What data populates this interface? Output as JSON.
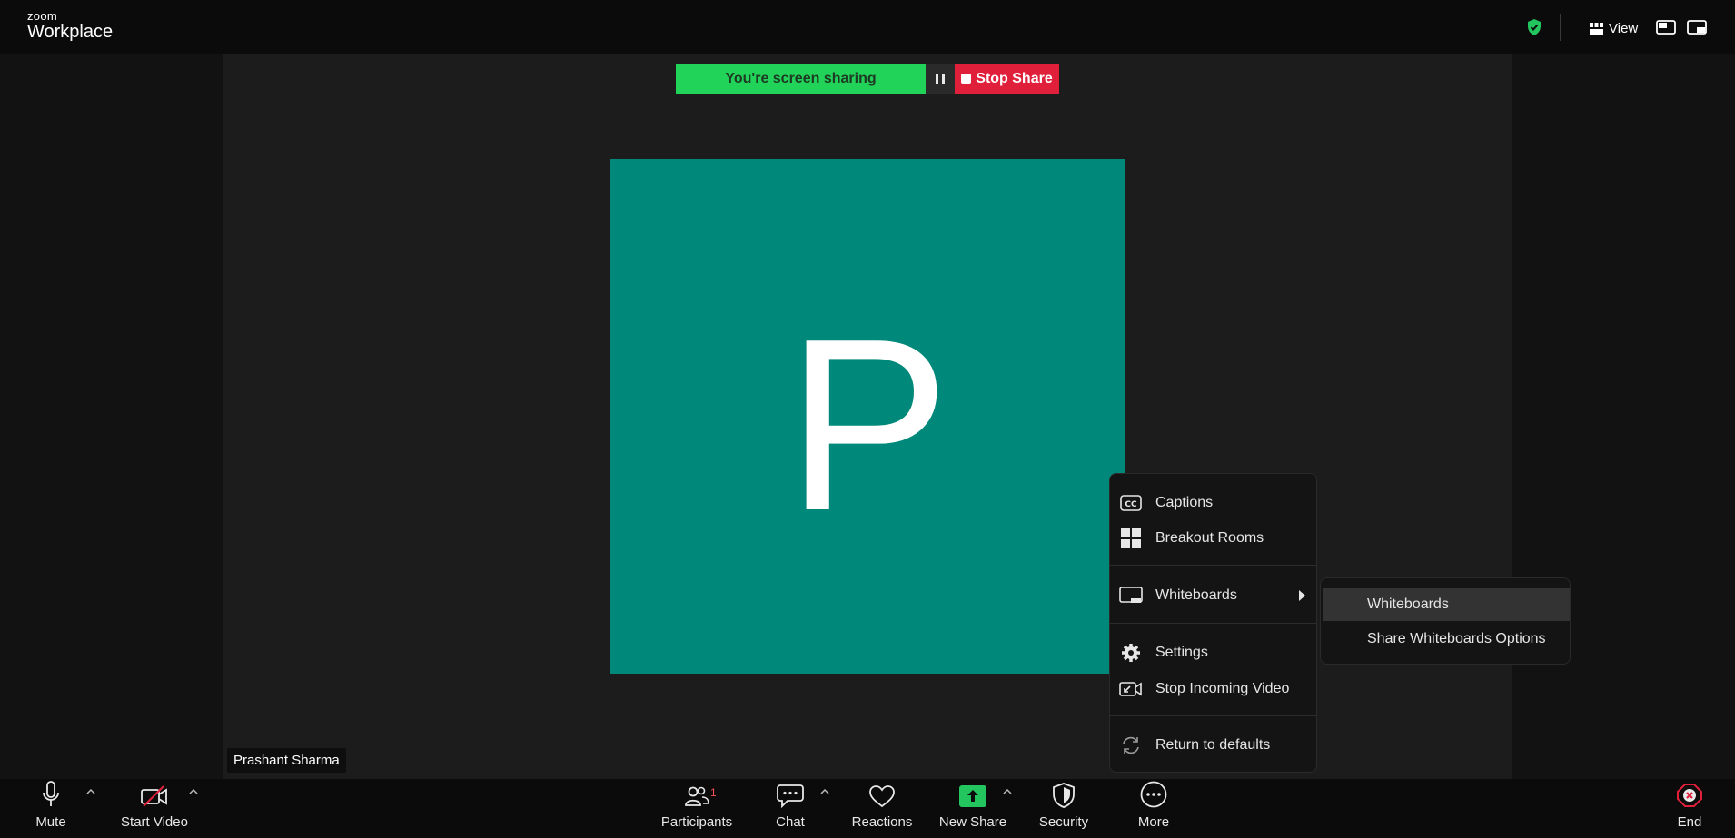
{
  "app": {
    "logo_small": "zoom",
    "logo_big": "Workplace"
  },
  "topbar": {
    "view_label": "View",
    "security_status_color": "#22c55e"
  },
  "share_bar": {
    "status_text": "You're screen sharing",
    "stop_label": "Stop Share",
    "status_color": "#22d35a",
    "stop_color": "#e0203a"
  },
  "video": {
    "avatar_initial": "P",
    "avatar_color": "#00887a",
    "participant_name": "Prashant Sharma"
  },
  "more_menu": {
    "items": [
      {
        "label": "Captions",
        "icon": "captions-icon"
      },
      {
        "label": "Breakout Rooms",
        "icon": "breakout-rooms-icon"
      },
      {
        "label": "Whiteboards",
        "icon": "whiteboard-icon"
      },
      {
        "label": "Settings",
        "icon": "gear-icon"
      },
      {
        "label": "Stop Incoming Video",
        "icon": "stop-incoming-video-icon"
      },
      {
        "label": "Return to defaults",
        "icon": "refresh-icon"
      }
    ]
  },
  "whiteboards_submenu": {
    "items": [
      {
        "label": "Whiteboards"
      },
      {
        "label": "Share Whiteboards Options"
      }
    ]
  },
  "toolbar": {
    "mute": "Mute",
    "start_video": "Start Video",
    "participants": "Participants",
    "participants_count": "1",
    "chat": "Chat",
    "reactions": "Reactions",
    "new_share": "New Share",
    "security": "Security",
    "more": "More",
    "end": "End",
    "share_color": "#22c55e",
    "end_color": "#e0203a"
  }
}
